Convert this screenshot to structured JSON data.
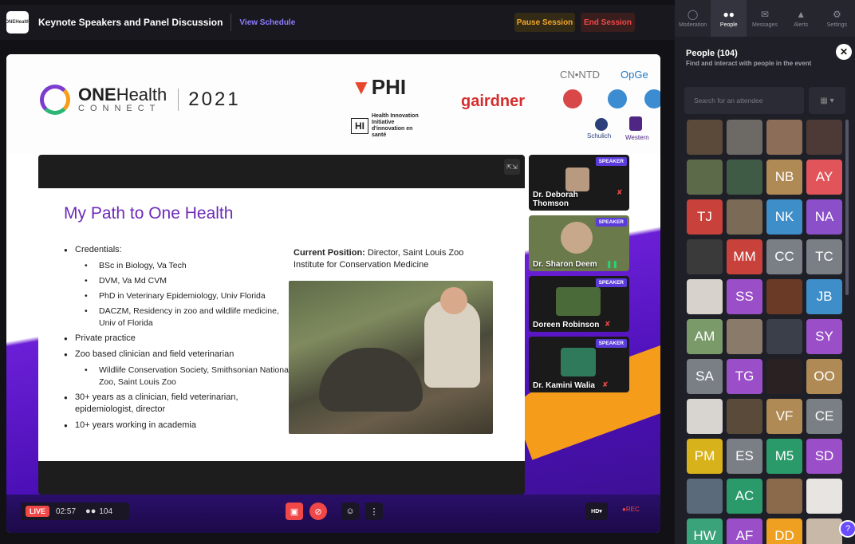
{
  "header": {
    "logo_text": "ONEHealth",
    "title": "Keynote Speakers and Panel Discussion",
    "view_schedule": "View Schedule",
    "pause_label": "Pause Session",
    "end_label": "End Session"
  },
  "banner": {
    "brand_one": "ONE",
    "brand_health": "Health",
    "brand_connect": "CONNECT",
    "year": "2021",
    "sponsor_phi": "PHI",
    "sponsor_hi": "HI",
    "sponsor_hi_text": "Health Innovation Initiative d'innovation en santé",
    "sponsor_gairdner": "gairdner",
    "sponsor_cn": "CN•NTD",
    "sponsor_opge": "OpGe",
    "sponsor_schulich": "Schulich",
    "sponsor_western": "Western"
  },
  "slide": {
    "title": "My Path to One Health",
    "bullets": [
      {
        "level": 1,
        "text": "Credentials:"
      },
      {
        "level": 2,
        "text": "BSc in Biology, Va Tech"
      },
      {
        "level": 2,
        "text": "DVM, Va Md CVM"
      },
      {
        "level": 2,
        "text": "PhD in Veterinary Epidemiology, Univ Florida"
      },
      {
        "level": 2,
        "text": "DACZM, Residency in zoo and wildlife medicine, Univ of Florida"
      },
      {
        "level": 1,
        "text": "Private practice"
      },
      {
        "level": 1,
        "text": "Zoo based clinician and field veterinarian"
      },
      {
        "level": 2,
        "text": "Wildlife Conservation Society, Smithsonian National Zoo, Saint Louis Zoo"
      },
      {
        "level": 1,
        "text": "30+ years as a clinician, field veterinarian, epidemiologist, director"
      },
      {
        "level": 1,
        "text": "10+ years working in academia"
      }
    ],
    "position_label": "Current Position:",
    "position_text": " Director, Saint Louis Zoo Institute for Conservation Medicine"
  },
  "speakers": [
    {
      "name": "Dr. Deborah Thomson",
      "badge": "SPEAKER",
      "muted": true
    },
    {
      "name": "Dr. Sharon Deem",
      "badge": "SPEAKER",
      "muted": false
    },
    {
      "name": "Doreen Robinson",
      "badge": "SPEAKER",
      "muted": true
    },
    {
      "name": "Dr. Kamini Walia",
      "badge": "SPEAKER",
      "muted": true
    }
  ],
  "controls": {
    "live": "LIVE",
    "timer": "02:57",
    "attendees": "104",
    "quality": "HD",
    "rec": "REC"
  },
  "panel": {
    "nav": [
      {
        "label": "Moderation",
        "icon": "shield-icon"
      },
      {
        "label": "People",
        "icon": "people-icon"
      },
      {
        "label": "Messages",
        "icon": "messages-icon"
      },
      {
        "label": "Alerts",
        "icon": "bell-icon"
      },
      {
        "label": "Settings",
        "icon": "gear-icon"
      }
    ],
    "title": "People (104)",
    "subtitle": "Find and interact with people in the event",
    "search_placeholder": "Search for an attendee",
    "people": [
      {
        "initials": "",
        "color": "#5b4a3a"
      },
      {
        "initials": "",
        "color": "#6d6a66"
      },
      {
        "initials": "",
        "color": "#8c6d58"
      },
      {
        "initials": "",
        "color": "#4d3a36"
      },
      {
        "initials": "",
        "color": "#5d6a4a"
      },
      {
        "initials": "",
        "color": "#3f5a45"
      },
      {
        "initials": "NB",
        "color": "#b08a55"
      },
      {
        "initials": "AY",
        "color": "#e0545a"
      },
      {
        "initials": "TJ",
        "color": "#c8413a"
      },
      {
        "initials": "",
        "color": "#7b6a55"
      },
      {
        "initials": "NK",
        "color": "#3d8ec9"
      },
      {
        "initials": "NA",
        "color": "#8b4fc9"
      },
      {
        "initials": "",
        "color": "#3a3a3a"
      },
      {
        "initials": "MM",
        "color": "#c8413a"
      },
      {
        "initials": "CC",
        "color": "#7a7f86"
      },
      {
        "initials": "TC",
        "color": "#7a7f86"
      },
      {
        "initials": "",
        "color": "#d8d2cc"
      },
      {
        "initials": "SS",
        "color": "#9a4fc9"
      },
      {
        "initials": "",
        "color": "#6a3a26"
      },
      {
        "initials": "JB",
        "color": "#3d8ec9"
      },
      {
        "initials": "AM",
        "color": "#7a9a6a"
      },
      {
        "initials": "",
        "color": "#8a7a6a"
      },
      {
        "initials": "",
        "color": "#3a3f4a"
      },
      {
        "initials": "SY",
        "color": "#9a4fc9"
      },
      {
        "initials": "SA",
        "color": "#7a7f86"
      },
      {
        "initials": "TG",
        "color": "#9a4fc9"
      },
      {
        "initials": "",
        "color": "#2a2222"
      },
      {
        "initials": "OO",
        "color": "#b08a55"
      },
      {
        "initials": "",
        "color": "#d8d4cf"
      },
      {
        "initials": "",
        "color": "#5a4a3a"
      },
      {
        "initials": "VF",
        "color": "#b08a55"
      },
      {
        "initials": "CE",
        "color": "#7a7f86"
      },
      {
        "initials": "PM",
        "color": "#d8b21a"
      },
      {
        "initials": "ES",
        "color": "#7a7f86"
      },
      {
        "initials": "M5",
        "color": "#2a9a6a"
      },
      {
        "initials": "SD",
        "color": "#9a4fc9"
      },
      {
        "initials": "",
        "color": "#5a6a7a"
      },
      {
        "initials": "AC",
        "color": "#2a9a6a"
      },
      {
        "initials": "",
        "color": "#8a6a4a"
      },
      {
        "initials": "",
        "color": "#e8e4e2"
      },
      {
        "initials": "HW",
        "color": "#3aa37a"
      },
      {
        "initials": "AF",
        "color": "#9a4fc9"
      },
      {
        "initials": "DD",
        "color": "#f0a020"
      },
      {
        "initials": "",
        "color": "#c8b8a8"
      }
    ]
  }
}
